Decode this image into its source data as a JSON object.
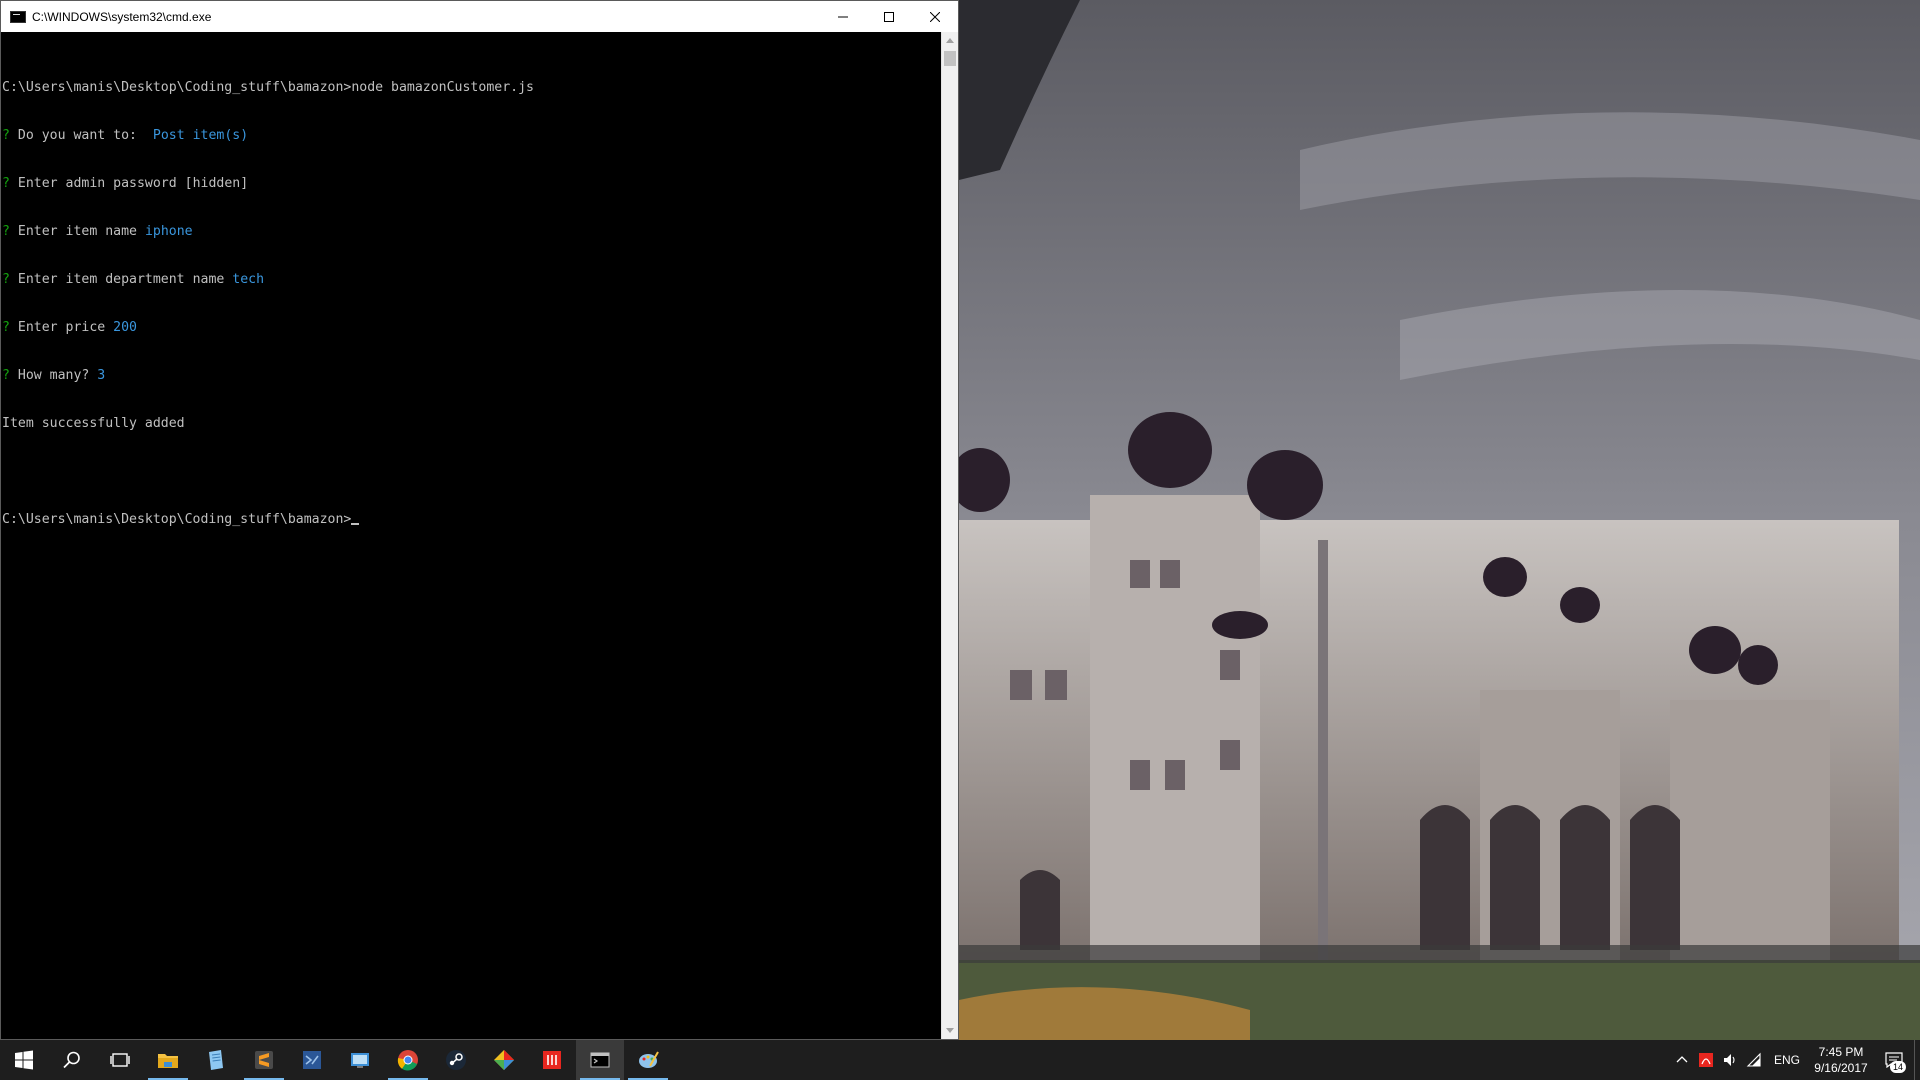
{
  "window": {
    "title": "C:\\WINDOWS\\system32\\cmd.exe"
  },
  "terminal": {
    "lines": [
      {
        "prompt": "C:\\Users\\manis\\Desktop\\Coding_stuff\\bamazon>",
        "command": "node bamazonCustomer.js"
      },
      {
        "marker": "?",
        "question": " Do you want to: ",
        "answer": " Post item(s)"
      },
      {
        "marker": "?",
        "question": " Enter admin password ",
        "answer_plain": "[hidden]"
      },
      {
        "marker": "?",
        "question": " Enter item name ",
        "answer": "iphone"
      },
      {
        "marker": "?",
        "question": " Enter item department name ",
        "answer": "tech"
      },
      {
        "marker": "?",
        "question": " Enter price ",
        "answer": "200"
      },
      {
        "marker": "?",
        "question": " How many? ",
        "answer": "3"
      },
      {
        "text": "Item successfully added"
      },
      {
        "text": ""
      },
      {
        "prompt": "C:\\Users\\manis\\Desktop\\Coding_stuff\\bamazon>"
      }
    ]
  },
  "taskbar": {
    "apps": [
      {
        "name": "start-icon",
        "color": "#ffffff"
      },
      {
        "name": "search-icon",
        "color": "#ffffff"
      },
      {
        "name": "task-view-icon",
        "color": "#ffffff"
      },
      {
        "name": "file-explorer-icon",
        "color": "#f5c242"
      },
      {
        "name": "notepad-icon",
        "color": "#6fb1e6"
      },
      {
        "name": "sublime-text-icon",
        "color": "#f59a23"
      },
      {
        "name": "visual-studio-icon",
        "color": "#6fa5d8"
      },
      {
        "name": "control-panel-icon",
        "color": "#3c8fd6"
      },
      {
        "name": "chrome-icon",
        "color": "#4caf50"
      },
      {
        "name": "steam-icon",
        "color": "#ffffff"
      },
      {
        "name": "git-icon",
        "color": "#f0c020"
      },
      {
        "name": "adobe-icon",
        "color": "#e8261f"
      },
      {
        "name": "cmd-icon",
        "color": "#c0c0c0"
      },
      {
        "name": "paint-icon",
        "color": "#8ec3ec"
      }
    ],
    "language": "ENG",
    "time": "7:45 PM",
    "date": "9/16/2017",
    "notification_count": "14"
  }
}
